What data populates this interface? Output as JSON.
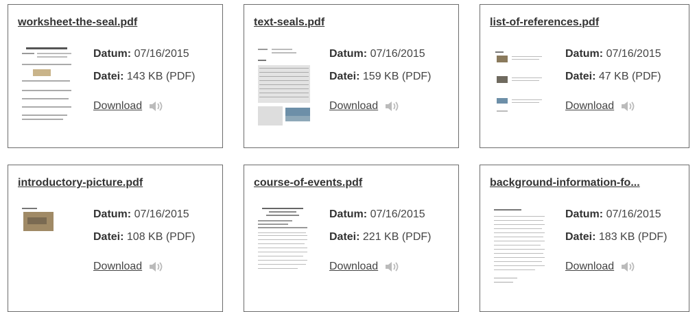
{
  "cards": [
    {
      "title": "worksheet-the-seal.pdf",
      "date_label": "Datum:",
      "date": "07/16/2015",
      "file_label": "Datei:",
      "file": "143 KB (PDF)",
      "download": "Download",
      "audio_icon": "speaker-icon"
    },
    {
      "title": "text-seals.pdf",
      "date_label": "Datum:",
      "date": "07/16/2015",
      "file_label": "Datei:",
      "file": "159 KB (PDF)",
      "download": "Download",
      "audio_icon": "speaker-icon"
    },
    {
      "title": "list-of-references.pdf",
      "date_label": "Datum:",
      "date": "07/16/2015",
      "file_label": "Datei:",
      "file": "47 KB (PDF)",
      "download": "Download",
      "audio_icon": "speaker-icon"
    },
    {
      "title": "introductory-picture.pdf",
      "date_label": "Datum:",
      "date": "07/16/2015",
      "file_label": "Datei:",
      "file": "108 KB (PDF)",
      "download": "Download",
      "audio_icon": "speaker-icon"
    },
    {
      "title": "course-of-events.pdf",
      "date_label": "Datum:",
      "date": "07/16/2015",
      "file_label": "Datei:",
      "file": "221 KB (PDF)",
      "download": "Download",
      "audio_icon": "speaker-icon"
    },
    {
      "title": "background-information-fo...",
      "date_label": "Datum:",
      "date": "07/16/2015",
      "file_label": "Datei:",
      "file": "183 KB (PDF)",
      "download": "Download",
      "audio_icon": "speaker-icon"
    }
  ]
}
